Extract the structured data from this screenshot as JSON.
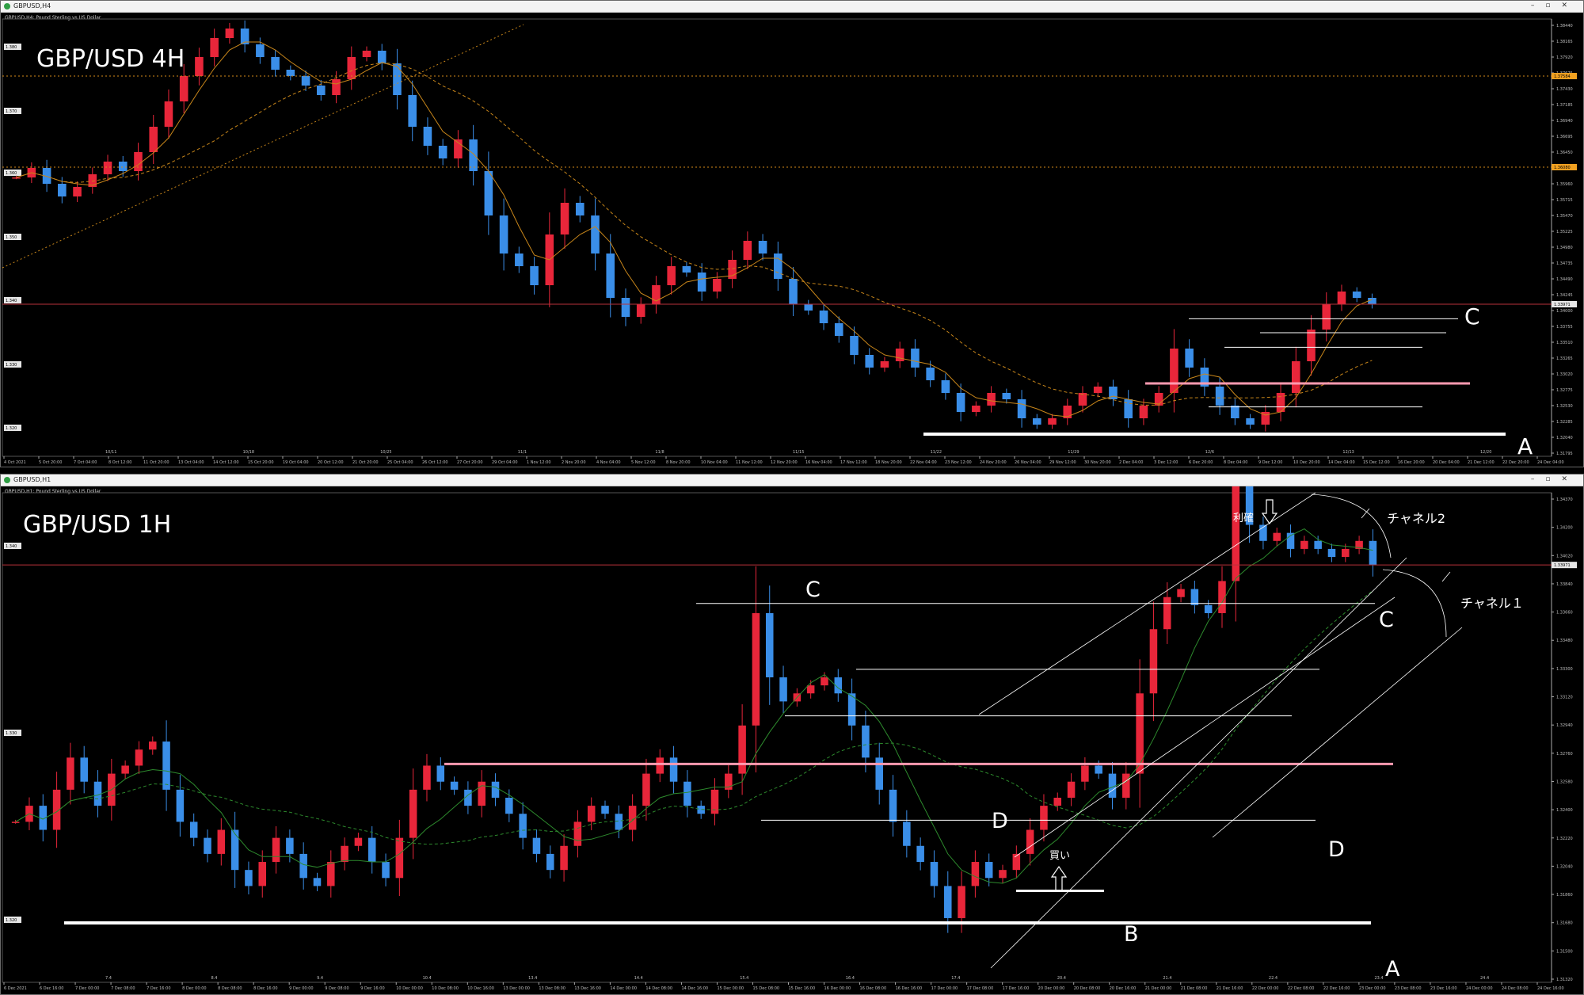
{
  "windows": [
    {
      "title": "GBPUSD,H4",
      "subtitle": "GBPUSD,H4: Pound Sterling vs US Dollar",
      "big_label": "GBP/USD  4H",
      "annotations": {
        "c": "C",
        "a": "A"
      },
      "price_label": "1.33971",
      "level_labels": [
        "1.37584",
        "1.36080"
      ],
      "y_ticks": [
        "1.38440",
        "1.38165",
        "1.37920",
        "1.37675",
        "1.37430",
        "1.37185",
        "1.36940",
        "1.36695",
        "1.36450",
        "1.36205",
        "1.35960",
        "1.35715",
        "1.35470",
        "1.35225",
        "1.34980",
        "1.34735",
        "1.34490",
        "1.34245",
        "1.34000",
        "1.33755",
        "1.33510",
        "1.33265",
        "1.33020",
        "1.32775",
        "1.32530",
        "1.32285",
        "1.32040",
        "1.31795"
      ],
      "left_labels": [
        "1.380",
        "1.370",
        "1.360",
        "1.350",
        "1.340",
        "1.330",
        "1.320"
      ],
      "x_ticks": [
        "4 Oct 2021",
        "5 Oct 20:00",
        "7 Oct 04:00",
        "8 Oct 12:00",
        "11 Oct 20:00",
        "13 Oct 04:00",
        "14 Oct 12:00",
        "15 Oct 20:00",
        "19 Oct 04:00",
        "20 Oct 12:00",
        "21 Oct 20:00",
        "25 Oct 04:00",
        "26 Oct 12:00",
        "27 Oct 20:00",
        "29 Oct 04:00",
        "1 Nov 12:00",
        "2 Nov 20:00",
        "4 Nov 04:00",
        "5 Nov 12:00",
        "8 Nov 20:00",
        "10 Nov 04:00",
        "11 Nov 12:00",
        "12 Nov 20:00",
        "16 Nov 04:00",
        "17 Nov 12:00",
        "18 Nov 20:00",
        "22 Nov 04:00",
        "23 Nov 12:00",
        "24 Nov 20:00",
        "26 Nov 04:00",
        "29 Nov 12:00",
        "30 Nov 20:00",
        "2 Dec 04:00",
        "3 Dec 12:00",
        "6 Dec 20:00",
        "8 Dec 04:00",
        "9 Dec 12:00",
        "10 Dec 20:00",
        "14 Dec 04:00",
        "15 Dec 12:00",
        "16 Dec 20:00",
        "20 Dec 04:00",
        "21 Dec 12:00",
        "22 Dec 20:00",
        "24 Dec 04:00"
      ],
      "period_ticks": [
        "10/11",
        "10/18",
        "10/25",
        "11/1",
        "11/8",
        "11/15",
        "11/22",
        "11/29",
        "12/6",
        "12/13",
        "12/20"
      ],
      "chart_data": {
        "type": "candlestick",
        "title": "GBP/USD  4H",
        "ylim": [
          1.316,
          1.385
        ],
        "series_close": [
          1.36,
          1.3615,
          1.359,
          1.357,
          1.3585,
          1.3605,
          1.3625,
          1.361,
          1.364,
          1.368,
          1.372,
          1.376,
          1.379,
          1.382,
          1.3835,
          1.381,
          1.379,
          1.377,
          1.376,
          1.3745,
          1.373,
          1.3755,
          1.379,
          1.38,
          1.378,
          1.373,
          1.368,
          1.365,
          1.363,
          1.366,
          1.361,
          1.354,
          1.348,
          1.346,
          1.343,
          1.351,
          1.356,
          1.354,
          1.348,
          1.341,
          1.338,
          1.34,
          1.343,
          1.346,
          1.345,
          1.342,
          1.344,
          1.347,
          1.35,
          1.348,
          1.344,
          1.34,
          1.339,
          1.337,
          1.335,
          1.332,
          1.33,
          1.331,
          1.333,
          1.33,
          1.328,
          1.326,
          1.323,
          1.324,
          1.326,
          1.325,
          1.322,
          1.321,
          1.322,
          1.324,
          1.326,
          1.327,
          1.325,
          1.322,
          1.324,
          1.326,
          1.333,
          1.33,
          1.327,
          1.324,
          1.322,
          1.321,
          1.323,
          1.326,
          1.331,
          1.336,
          1.34,
          1.342,
          1.341,
          1.34
        ],
        "horizontal_levels": [
          {
            "label": "C",
            "price": 1.3377
          },
          {
            "price": 1.3355
          },
          {
            "price": 1.3332
          },
          {
            "price": 1.3275,
            "color": "#ff9ab0"
          },
          {
            "price": 1.3238
          },
          {
            "label": "A",
            "price": 1.3195
          }
        ]
      }
    },
    {
      "title": "GBPUSD,H1",
      "subtitle": "GBPUSD,H1: Pound Sterling vs US Dollar",
      "big_label": "GBP/USD  1H",
      "annotations": {
        "c1": "C",
        "c2": "C",
        "d1": "D",
        "d2": "D",
        "b": "B",
        "a": "A",
        "buy": "買い",
        "take_profit": "利確",
        "channel1": "チャネル１",
        "channel2": "チャネル2"
      },
      "price_label": "1.33971",
      "y_ticks": [
        "1.34370",
        "1.34200",
        "1.34020",
        "1.33840",
        "1.33660",
        "1.33480",
        "1.33300",
        "1.33120",
        "1.32940",
        "1.32760",
        "1.32580",
        "1.32400",
        "1.32220",
        "1.32040",
        "1.31860",
        "1.31680",
        "1.31500",
        "1.31320"
      ],
      "left_labels": [
        "1.340",
        "1.330",
        "1.320"
      ],
      "x_ticks": [
        "6 Dec 2021",
        "6 Dec 16:00",
        "7 Dec 00:00",
        "7 Dec 08:00",
        "7 Dec 16:00",
        "8 Dec 00:00",
        "8 Dec 08:00",
        "8 Dec 16:00",
        "9 Dec 00:00",
        "9 Dec 08:00",
        "9 Dec 16:00",
        "10 Dec 00:00",
        "10 Dec 08:00",
        "10 Dec 16:00",
        "13 Dec 00:00",
        "13 Dec 08:00",
        "13 Dec 16:00",
        "14 Dec 00:00",
        "14 Dec 08:00",
        "14 Dec 16:00",
        "15 Dec 00:00",
        "15 Dec 08:00",
        "15 Dec 16:00",
        "16 Dec 00:00",
        "16 Dec 08:00",
        "16 Dec 16:00",
        "17 Dec 00:00",
        "17 Dec 08:00",
        "17 Dec 16:00",
        "20 Dec 00:00",
        "20 Dec 08:00",
        "20 Dec 16:00",
        "21 Dec 00:00",
        "21 Dec 08:00",
        "21 Dec 16:00",
        "22 Dec 00:00",
        "22 Dec 08:00",
        "22 Dec 16:00",
        "23 Dec 00:00",
        "23 Dec 08:00",
        "23 Dec 16:00",
        "24 Dec 00:00",
        "24 Dec 08:00",
        "24 Dec 16:00"
      ],
      "period_ticks": [
        "7.4",
        "8.4",
        "9.4",
        "10.4",
        "13.4",
        "14.4",
        "15.4",
        "16.4",
        "17.4",
        "20.4",
        "21.4",
        "22.4",
        "23.4",
        "24.4"
      ],
      "chart_data": {
        "type": "candlestick",
        "title": "GBP/USD  1H",
        "ylim": [
          1.314,
          1.3445
        ],
        "series_close": [
          1.324,
          1.325,
          1.3235,
          1.326,
          1.328,
          1.3265,
          1.325,
          1.327,
          1.3275,
          1.3285,
          1.329,
          1.326,
          1.324,
          1.323,
          1.322,
          1.3235,
          1.321,
          1.32,
          1.3215,
          1.323,
          1.322,
          1.3205,
          1.32,
          1.3215,
          1.3225,
          1.323,
          1.3215,
          1.3205,
          1.323,
          1.326,
          1.3275,
          1.3265,
          1.326,
          1.325,
          1.3265,
          1.3255,
          1.3245,
          1.323,
          1.322,
          1.321,
          1.3225,
          1.324,
          1.325,
          1.3245,
          1.3235,
          1.325,
          1.327,
          1.328,
          1.3265,
          1.325,
          1.3245,
          1.326,
          1.327,
          1.33,
          1.337,
          1.333,
          1.3315,
          1.332,
          1.3325,
          1.333,
          1.332,
          1.33,
          1.328,
          1.326,
          1.324,
          1.3225,
          1.3215,
          1.32,
          1.318,
          1.32,
          1.3215,
          1.3205,
          1.321,
          1.322,
          1.3235,
          1.325,
          1.3255,
          1.3265,
          1.3275,
          1.327,
          1.3255,
          1.327,
          1.332,
          1.336,
          1.338,
          1.3385,
          1.3375,
          1.337,
          1.339,
          1.345,
          1.3425,
          1.3415,
          1.342,
          1.341,
          1.3415,
          1.341,
          1.3405,
          1.341,
          1.3415,
          1.34
        ],
        "horizontal_levels": [
          {
            "label": "C",
            "price": 1.3376
          },
          {
            "price": 1.3335
          },
          {
            "price": 1.3306
          },
          {
            "price": 1.3276,
            "color": "#ff9ab0"
          },
          {
            "label": "D",
            "price": 1.3241
          },
          {
            "label": "B",
            "price": 1.3197
          },
          {
            "label": "A",
            "price": 1.3177
          }
        ]
      }
    }
  ],
  "colors": {
    "background": "#000000",
    "bull": "#e8263a",
    "bear": "#3a8ee8",
    "ma_fast": "#c8861a",
    "ma_slow": "#c8861a",
    "ma_green": "#2d8a2d",
    "level_white": "#ffffff",
    "level_pink": "#ff9ab0",
    "price_line": "#b8323a"
  }
}
